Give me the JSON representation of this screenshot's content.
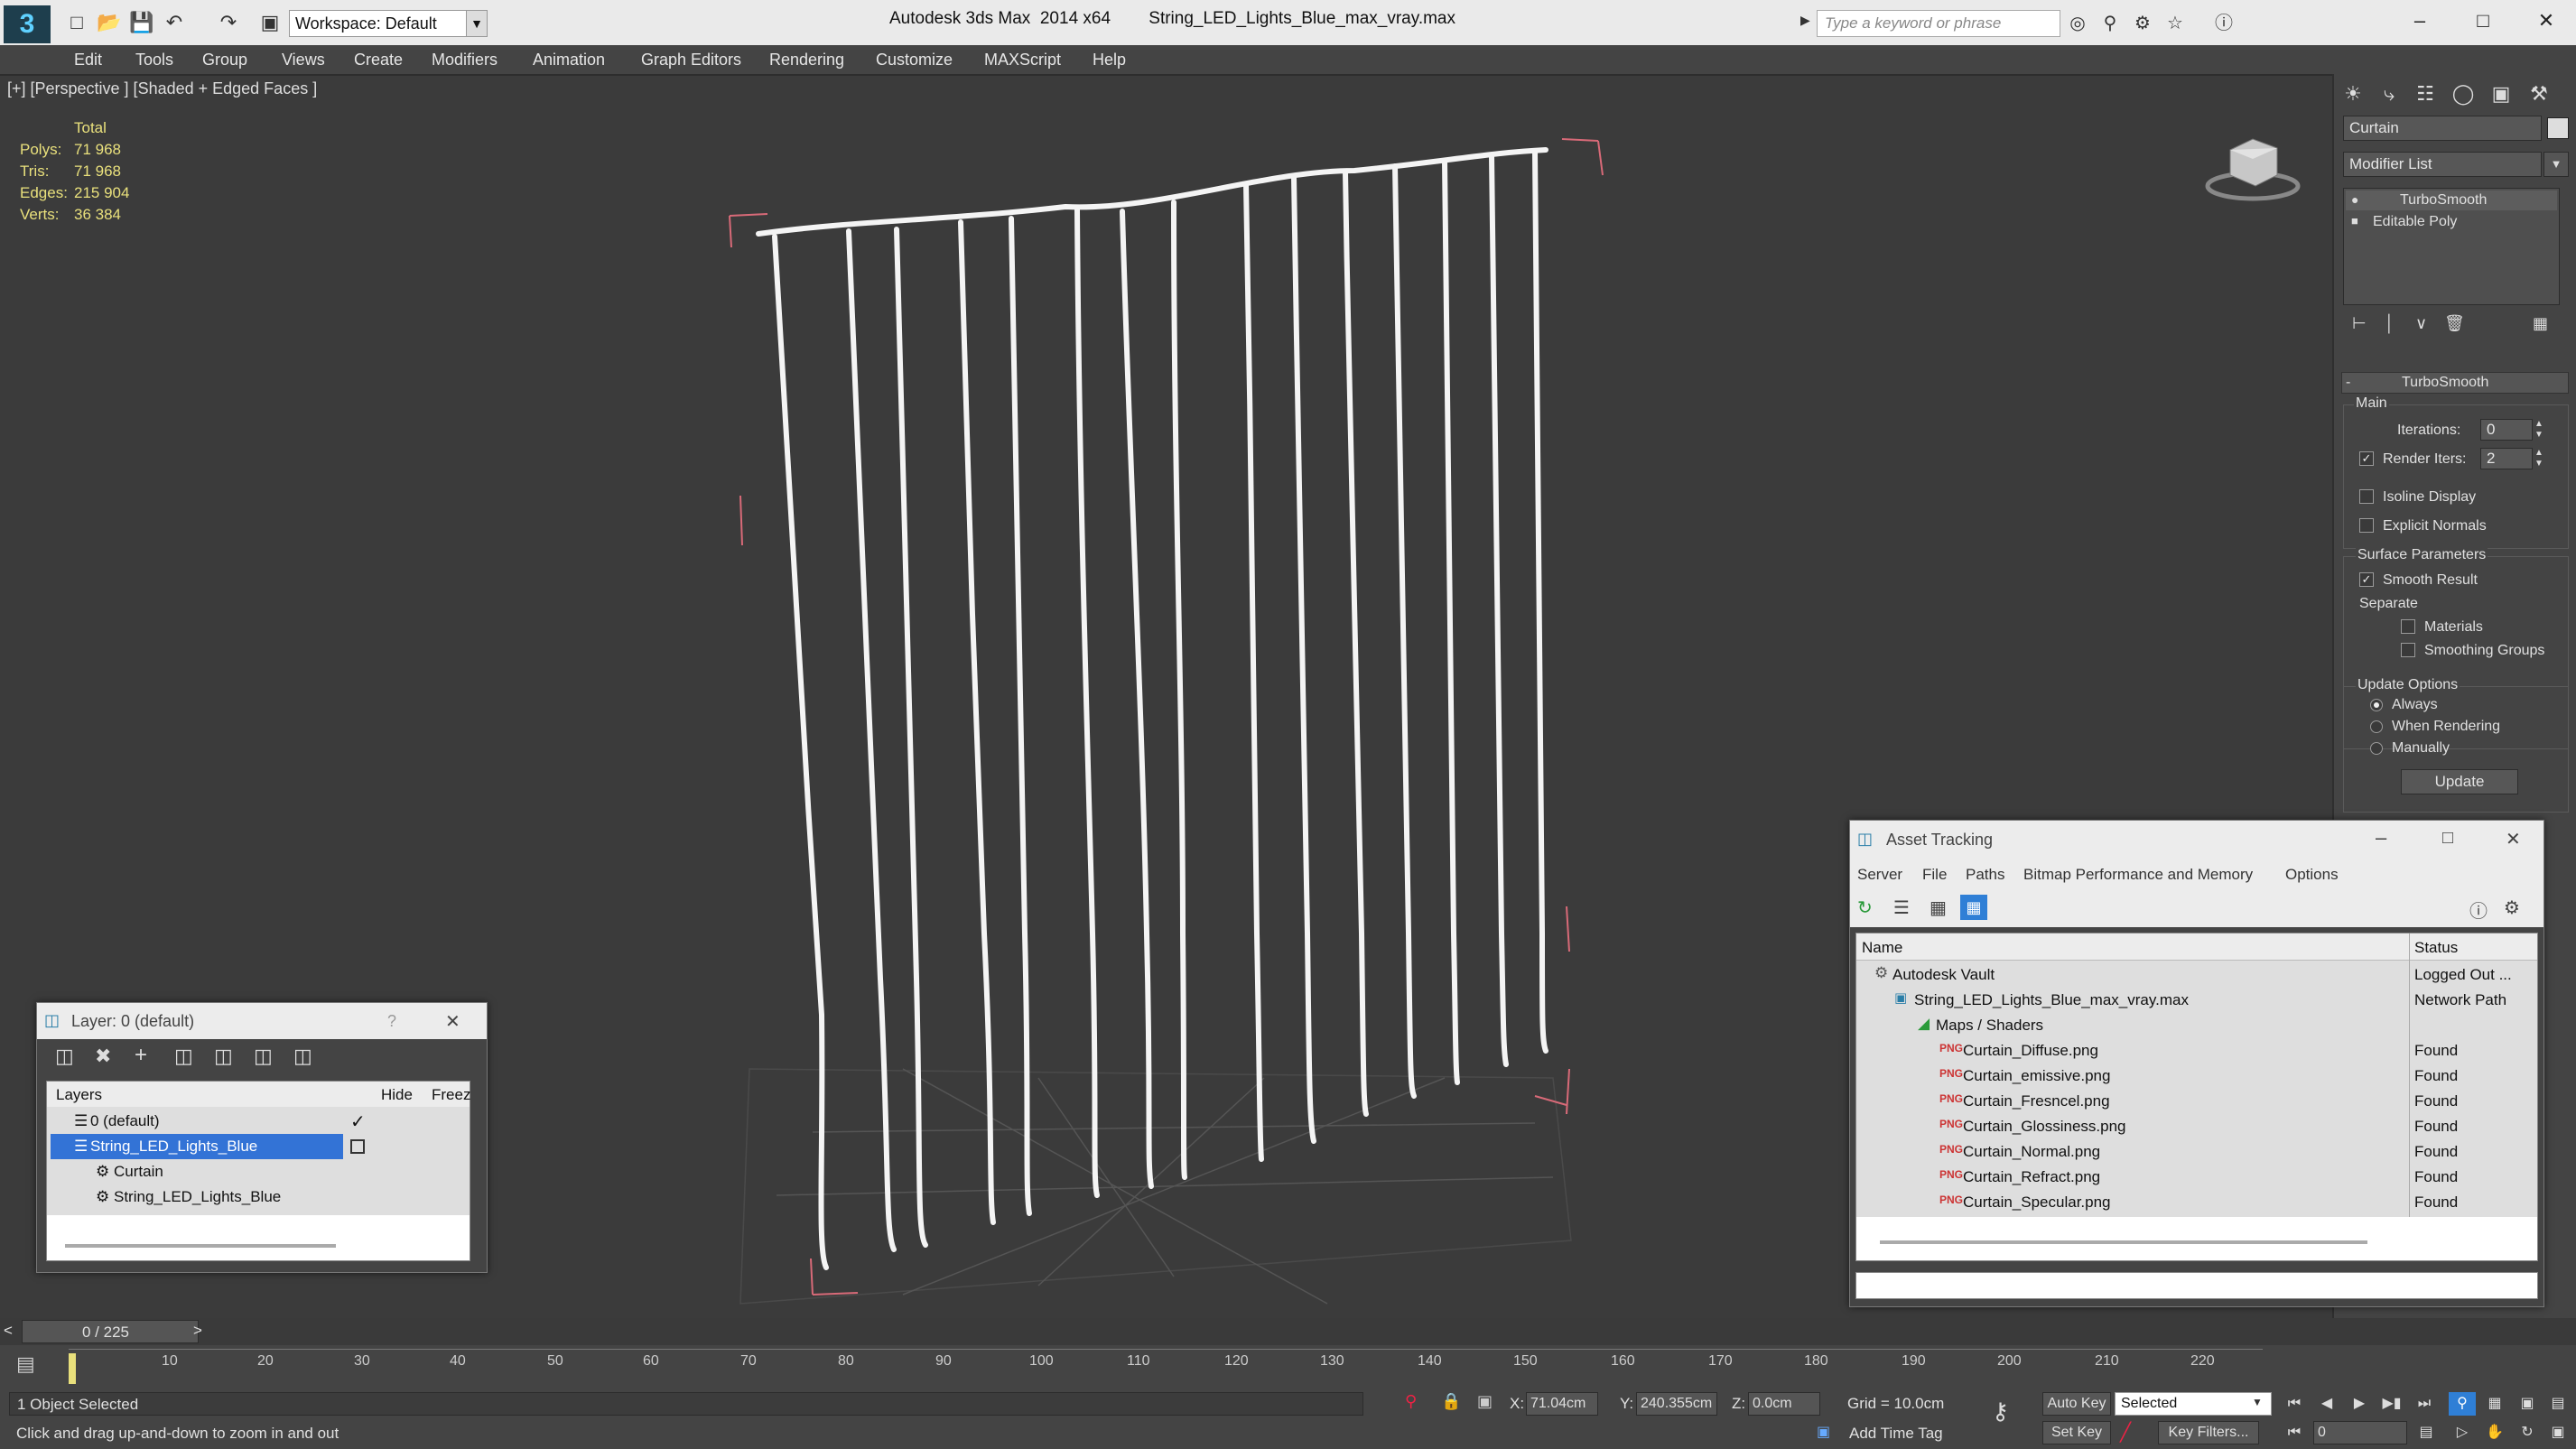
{
  "titlebar": {
    "workspace": "Workspace: Default",
    "app": "Autodesk 3ds Max  2014 x64",
    "file": "String_LED_Lights_Blue_max_vray.max",
    "search_placeholder": "Type a keyword or phrase"
  },
  "menu": [
    "Edit",
    "Tools",
    "Group",
    "Views",
    "Create",
    "Modifiers",
    "Animation",
    "Graph Editors",
    "Rendering",
    "Customize",
    "MAXScript",
    "Help"
  ],
  "viewport": {
    "label": "[+] [Perspective ] [Shaded + Edged Faces ]",
    "stats": {
      "total_label": "Total",
      "rows": [
        {
          "label": "Polys:",
          "value": "71 968"
        },
        {
          "label": "Tris:",
          "value": "71 968"
        },
        {
          "label": "Edges:",
          "value": "215 904"
        },
        {
          "label": "Verts:",
          "value": "36 384"
        }
      ]
    }
  },
  "command_panel": {
    "object_name": "Curtain",
    "modifier_list": "Modifier List",
    "stack": [
      "TurboSmooth",
      "Editable Poly"
    ],
    "rollout_title": "TurboSmooth",
    "main_label": "Main",
    "iterations_label": "Iterations:",
    "iterations_value": "0",
    "render_iters_label": "Render Iters:",
    "render_iters_value": "2",
    "isoline": "Isoline Display",
    "explicit": "Explicit Normals",
    "surface_params": "Surface Parameters",
    "smooth_result": "Smooth Result",
    "separate": "Separate",
    "materials": "Materials",
    "smoothing_groups": "Smoothing Groups",
    "update_options": "Update Options",
    "always": "Always",
    "when_rendering": "When Rendering",
    "manually": "Manually",
    "update_btn": "Update"
  },
  "layer_window": {
    "title": "Layer: 0 (default)",
    "help": "?",
    "col_layers": "Layers",
    "col_hide": "Hide",
    "col_freeze": "Freez",
    "rows": [
      {
        "name": "0 (default)",
        "indent": 0
      },
      {
        "name": "String_LED_Lights_Blue",
        "indent": 0,
        "selected": true
      },
      {
        "name": "Curtain",
        "indent": 1
      },
      {
        "name": "String_LED_Lights_Blue",
        "indent": 1
      }
    ]
  },
  "asset_window": {
    "title": "Asset Tracking",
    "menu": [
      "Server",
      "File",
      "Paths",
      "Bitmap Performance and Memory",
      "Options"
    ],
    "col_name": "Name",
    "col_status": "Status",
    "rows": [
      {
        "name": "Autodesk Vault",
        "status": "Logged Out ...",
        "indent": 0
      },
      {
        "name": "String_LED_Lights_Blue_max_vray.max",
        "status": "Network Path",
        "indent": 1
      },
      {
        "name": "Maps / Shaders",
        "status": "",
        "indent": 2
      },
      {
        "name": "Curtain_Diffuse.png",
        "status": "Found",
        "indent": 3
      },
      {
        "name": "Curtain_emissive.png",
        "status": "Found",
        "indent": 3
      },
      {
        "name": "Curtain_Fresncel.png",
        "status": "Found",
        "indent": 3
      },
      {
        "name": "Curtain_Glossiness.png",
        "status": "Found",
        "indent": 3
      },
      {
        "name": "Curtain_Normal.png",
        "status": "Found",
        "indent": 3
      },
      {
        "name": "Curtain_Refract.png",
        "status": "Found",
        "indent": 3
      },
      {
        "name": "Curtain_Specular.png",
        "status": "Found",
        "indent": 3
      }
    ]
  },
  "timeline": {
    "frame": "0 / 225",
    "prev": "<",
    "next": ">",
    "ticks": [
      "10",
      "20",
      "30",
      "40",
      "50",
      "60",
      "70",
      "80",
      "90",
      "100",
      "110",
      "120",
      "130",
      "140",
      "150",
      "160",
      "170",
      "180",
      "190",
      "200",
      "210",
      "220"
    ]
  },
  "status": {
    "selected": "1 Object Selected",
    "hint": "Click and drag up-and-down to zoom in and out",
    "x_label": "X:",
    "x_value": "71.04cm",
    "y_label": "Y:",
    "y_value": "240.355cm",
    "z_label": "Z:",
    "z_value": "0.0cm",
    "grid": "Grid = 10.0cm",
    "add_time_tag": "Add Time Tag",
    "auto_key": "Auto Key",
    "set_key": "Set Key",
    "selected_mode": "Selected",
    "key_filters": "Key Filters...",
    "frame_field": "0"
  }
}
